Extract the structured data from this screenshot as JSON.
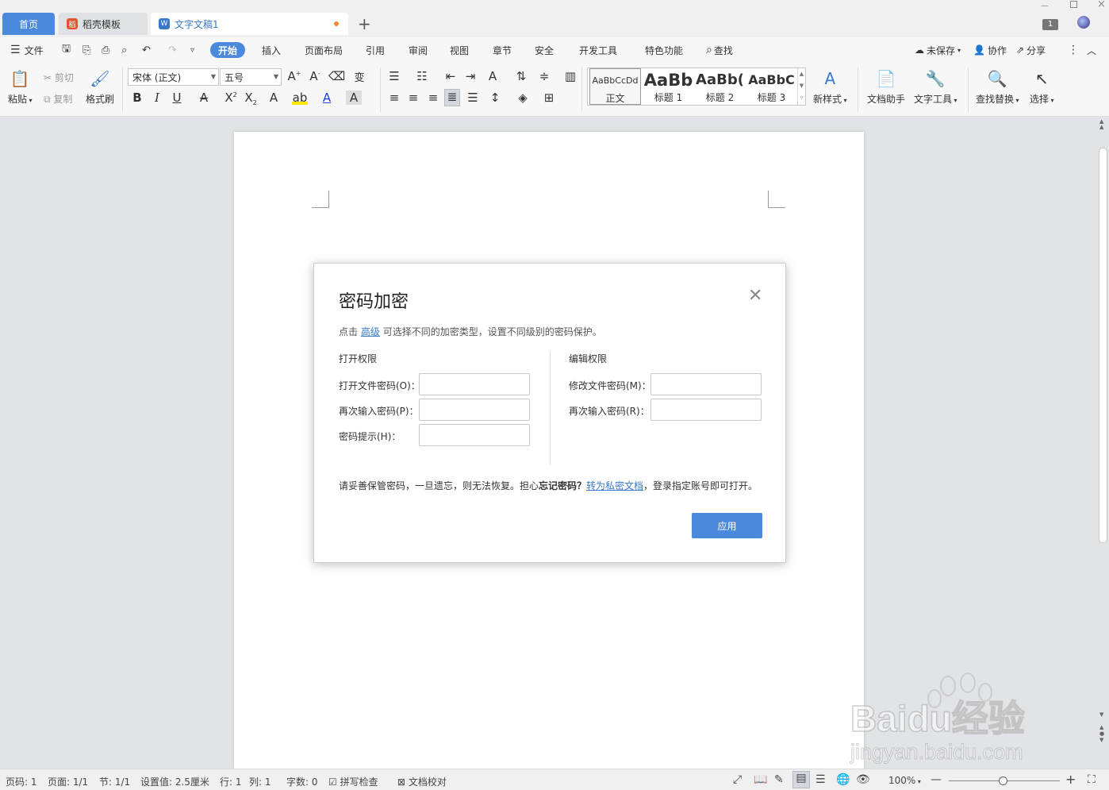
{
  "tabs": [
    {
      "label": "首页"
    },
    {
      "label": "稻壳模板"
    },
    {
      "label": "文字文稿1"
    }
  ],
  "window": {
    "page_badge": "1"
  },
  "menu": {
    "file": "文件",
    "items": [
      "开始",
      "插入",
      "页面布局",
      "引用",
      "审阅",
      "视图",
      "章节",
      "安全",
      "开发工具",
      "特色功能"
    ],
    "search": "查找",
    "unsaved": "未保存",
    "collab": "协作",
    "share": "分享"
  },
  "ribbon": {
    "paste": "粘贴",
    "cut": "剪切",
    "copy": "复制",
    "format_painter": "格式刷",
    "font_name": "宋体 (正文)",
    "font_size": "五号",
    "styles": [
      {
        "preview": "AaBbCcDd",
        "label": "正文"
      },
      {
        "preview": "AaBb",
        "label": "标题 1"
      },
      {
        "preview": "AaBb(",
        "label": "标题 2"
      },
      {
        "preview": "AaBbC",
        "label": "标题 3"
      }
    ],
    "new_style": "新样式",
    "doc_assistant": "文档助手",
    "text_tools": "文字工具",
    "find_replace": "查找替换",
    "select": "选择"
  },
  "dialog": {
    "title": "密码加密",
    "desc_prefix": "点击",
    "desc_link": "高级",
    "desc_suffix": "可选择不同的加密类型，设置不同级别的密码保护。",
    "open_section": "打开权限",
    "open_password_label": "打开文件密码(O)：",
    "open_reenter_label": "再次输入密码(P)：",
    "hint_label": "密码提示(H)：",
    "edit_section": "编辑权限",
    "edit_password_label": "修改文件密码(M)：",
    "edit_reenter_label": "再次输入密码(R)：",
    "note_prefix": "请妥善保管密码，一旦遗忘，则无法恢复。担心",
    "note_bold": "忘记密码？",
    "note_link": "转为私密文档",
    "note_suffix": "，登录指定账号即可打开。",
    "apply": "应用"
  },
  "status": {
    "page_num": "页码: 1",
    "pages": "页面: 1/1",
    "section": "节: 1/1",
    "setting": "设置值: 2.5厘米",
    "row": "行: 1",
    "col": "列: 1",
    "words": "字数: 0",
    "spell": "拼写检查",
    "proof": "文档校对",
    "zoom": "100%"
  },
  "watermark": {
    "brand": "Baidu经验",
    "url": "jingyan.baidu.com"
  }
}
